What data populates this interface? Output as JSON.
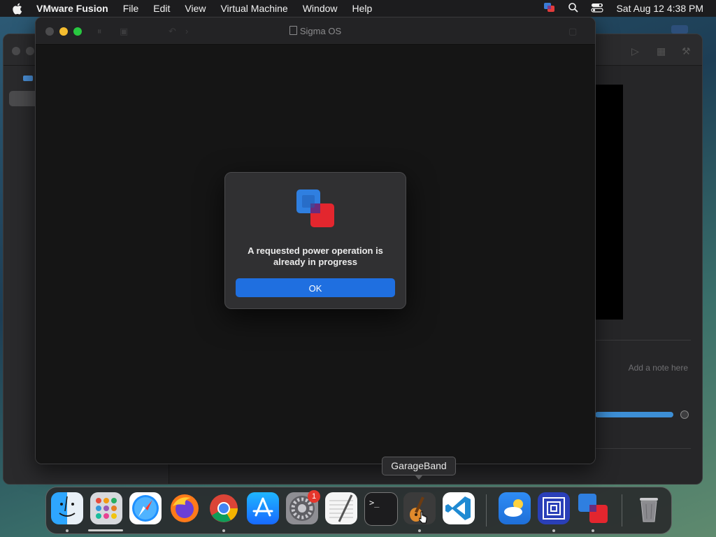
{
  "menubar": {
    "app_name": "VMware Fusion",
    "items": [
      "File",
      "Edit",
      "View",
      "Virtual Machine",
      "Window",
      "Help"
    ],
    "datetime": "Sat Aug 12  4:38 PM"
  },
  "background_window": {
    "note_placeholder": "Add a note here"
  },
  "vm_window": {
    "title": "Sigma OS"
  },
  "dialog": {
    "message": "A requested power operation is already in progress",
    "ok_label": "OK"
  },
  "tooltip": {
    "label": "GarageBand"
  },
  "dock": {
    "items": [
      {
        "name": "Finder",
        "icon": "finder-icon"
      },
      {
        "name": "Launchpad",
        "icon": "launchpad-icon"
      },
      {
        "name": "Safari",
        "icon": "safari-icon"
      },
      {
        "name": "Firefox",
        "icon": "firefox-icon"
      },
      {
        "name": "Chrome",
        "icon": "chrome-icon"
      },
      {
        "name": "App Store",
        "icon": "app-store-icon"
      },
      {
        "name": "System Preferences",
        "icon": "settings-icon"
      },
      {
        "name": "TextEdit",
        "icon": "textedit-icon"
      },
      {
        "name": "Terminal",
        "icon": "terminal-icon"
      },
      {
        "name": "GarageBand",
        "icon": "guitar-icon"
      },
      {
        "name": "Visual Studio Code",
        "icon": "vscode-icon"
      },
      {
        "name": "Weather",
        "icon": "weather-icon"
      },
      {
        "name": "Screens",
        "icon": "screens-icon"
      },
      {
        "name": "VMware Fusion",
        "icon": "vmware-icon"
      },
      {
        "name": "Trash",
        "icon": "trash-icon"
      }
    ],
    "settings_badge": "1"
  },
  "colors": {
    "accent_blue": "#1f6fe0",
    "menubar_bg": "#1c1c1e",
    "badge_red": "#e5362c"
  }
}
